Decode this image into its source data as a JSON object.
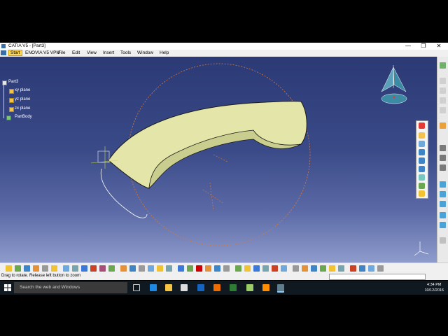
{
  "window": {
    "title": "CATIA V5 - [Part3]",
    "minimize": "—",
    "restore": "❐",
    "close": "✕"
  },
  "menu": {
    "start": "Start",
    "items": [
      "ENOVIA V5 VPM",
      "File",
      "Edit",
      "View",
      "Insert",
      "Tools",
      "Window",
      "Help"
    ]
  },
  "tree": {
    "root": "Part3",
    "items": [
      "xy plane",
      "yz plane",
      "zx plane",
      "PartBody"
    ]
  },
  "status": {
    "message": "Drag to rotate. Release left button to zoom"
  },
  "taskbar": {
    "search_placeholder": "Search the web and Windows",
    "time": "4:34 PM",
    "date": "10/12/2016"
  },
  "colors": {
    "viewport_top": "#2b3a75",
    "viewport_bottom": "#8e9bcc",
    "part_fill": "#dfe3a4",
    "part_inner": "#c4c98a",
    "circle": "#d77a3a"
  },
  "icons": {
    "start_icon": "windows-logo",
    "compass": "compass-icon",
    "axis": "axis-triad-icon"
  }
}
